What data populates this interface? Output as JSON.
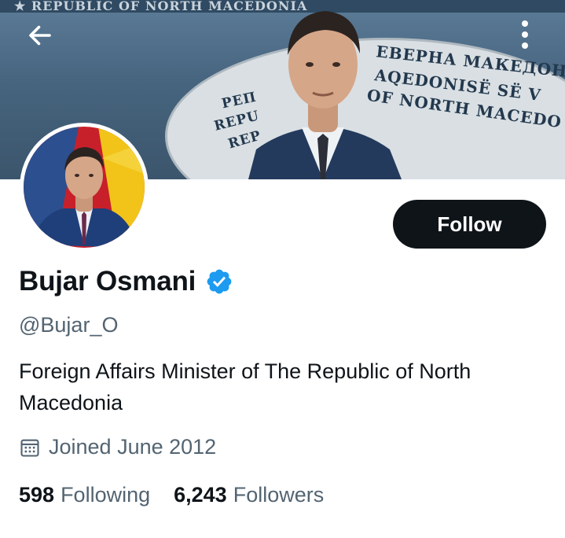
{
  "banner": {
    "strip_text": "★ REPUBLIC OF NORTH MACEDONIA",
    "seal_lines_right": [
      "ЕВЕРНА МАКЕДОН",
      "AQEDONISË SË V",
      "OF NORTH MACEDO"
    ],
    "seal_lines_left": [
      "РЕП",
      "REPU",
      "REP"
    ]
  },
  "profile": {
    "display_name": "Bujar Osmani",
    "handle": "@Bujar_O",
    "bio": "Foreign Affairs Minister of The Republic of North Macedonia",
    "joined": "Joined June 2012",
    "verified": true
  },
  "actions": {
    "follow_label": "Follow"
  },
  "stats": {
    "following_count": "598",
    "following_label": "Following",
    "followers_count": "6,243",
    "followers_label": "Followers"
  },
  "icons": {
    "back": "arrow-left-icon",
    "more": "more-vertical-icon",
    "verified": "verified-badge-icon",
    "calendar": "calendar-icon"
  },
  "colors": {
    "primary_text": "#0f1419",
    "secondary_text": "#536471",
    "verified_blue": "#1d9bf0",
    "follow_bg": "#0f1419"
  }
}
